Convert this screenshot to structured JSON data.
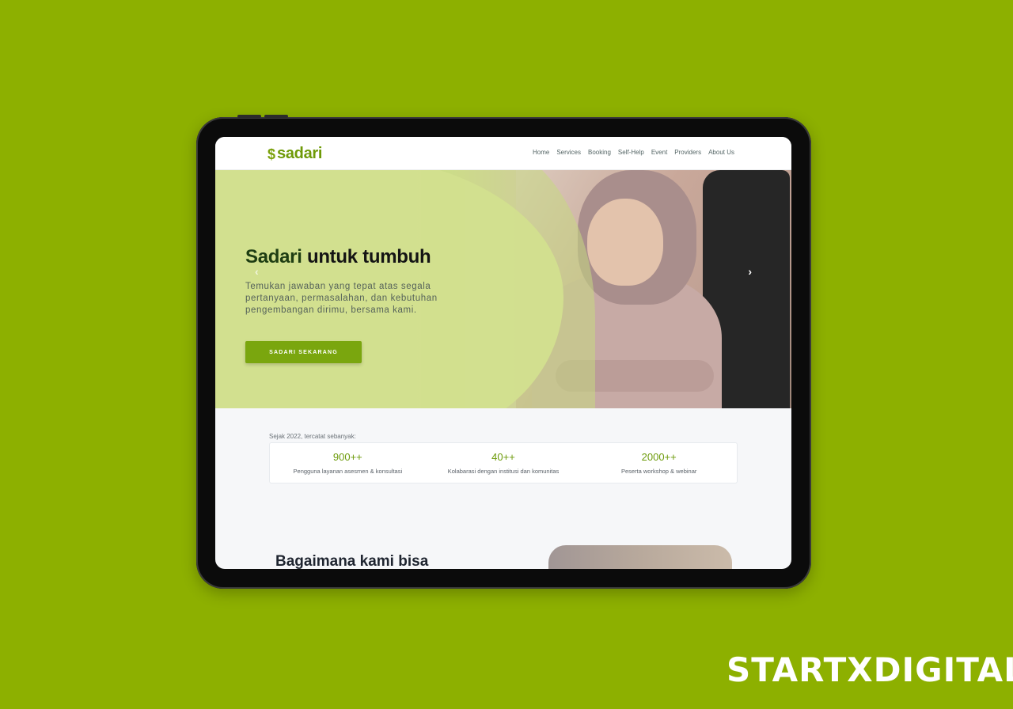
{
  "nav": {
    "logo_mark": "$",
    "logo_text": "sadari",
    "items": [
      "Home",
      "Services",
      "Booking",
      "Self-Help",
      "Event",
      "Providers",
      "About Us"
    ]
  },
  "hero": {
    "title_brand": "Sadari",
    "title_rest": "untuk tumbuh",
    "description": "Temukan jawaban yang tepat atas segala pertanyaan, permasalahan, dan kebutuhan pengembangan dirimu, bersama kami.",
    "cta_label": "SADARI SEKARANG",
    "prev_icon": "‹",
    "next_icon": "›"
  },
  "stats": {
    "intro": "Sejak 2022, tercatat sebanyak:",
    "items": [
      {
        "value": "900++",
        "label": "Pengguna layanan asesmen & konsultasi"
      },
      {
        "value": "40++",
        "label": "Kolabarasi dengan institusi dan komunitas"
      },
      {
        "value": "2000++",
        "label": "Peserta workshop & webinar"
      }
    ]
  },
  "section": {
    "title": "Bagaimana kami bisa"
  },
  "footer_brand": "STARTXDIGITAL",
  "colors": {
    "background": "#8db000",
    "accent": "#7aa60e"
  }
}
